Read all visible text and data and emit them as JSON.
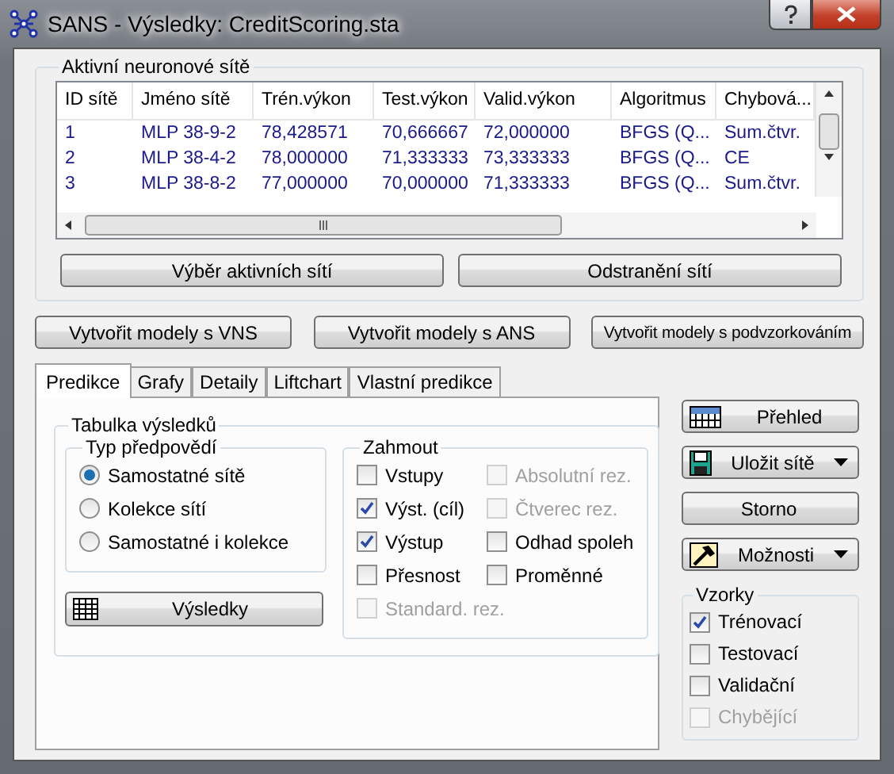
{
  "window": {
    "title": "SANS - Výsledky: CreditScoring.sta"
  },
  "active_networks": {
    "title": "Aktivní neuronové sítě",
    "columns": [
      "ID sítě",
      "Jméno sítě",
      "Trén.výkon",
      "Test.výkon",
      "Valid.výkon",
      "Algoritmus",
      "Chybová..."
    ],
    "rows": [
      [
        "1",
        "MLP 38-9-2",
        "78,428571",
        "70,666667",
        "72,000000",
        "BFGS (Q...",
        "Sum.čtvr."
      ],
      [
        "2",
        "MLP 38-4-2",
        "78,000000",
        "71,333333",
        "73,333333",
        "BFGS (Q...",
        "CE"
      ],
      [
        "3",
        "MLP 38-8-2",
        "77,000000",
        "70,000000",
        "71,333333",
        "BFGS (Q...",
        "Sum.čtvr."
      ]
    ],
    "buttons": [
      "Výběr aktivních sítí",
      "Odstranění sítí"
    ]
  },
  "model_buttons": [
    "Vytvořit modely s VNS",
    "Vytvořit modely s ANS",
    "Vytvořit modely s podvzorkováním"
  ],
  "tabs": [
    {
      "label": "Predikce",
      "selected": true
    },
    {
      "label": "Grafy",
      "selected": false
    },
    {
      "label": "Detaily",
      "selected": false
    },
    {
      "label": "Liftchart",
      "selected": false
    },
    {
      "label": "Vlastní predikce",
      "selected": false
    }
  ],
  "results_table": {
    "title": "Tabulka výsledků",
    "prediction_type": {
      "title": "Typ předpovědí",
      "options": [
        {
          "label": "Samostatné sítě",
          "selected": true
        },
        {
          "label": "Kolekce sítí",
          "selected": false
        },
        {
          "label": "Samostatné i kolekce",
          "selected": false
        }
      ]
    },
    "results_button": {
      "label": "Výsledky",
      "kind": "grid"
    },
    "include": {
      "title": "Zahmout",
      "options": [
        {
          "label": "Vstupy",
          "checked": false,
          "disabled": false
        },
        {
          "label": "Absolutní rez.",
          "checked": false,
          "disabled": true
        },
        {
          "label": "Výst. (cíl)",
          "checked": true,
          "disabled": false
        },
        {
          "label": "Čtverec rez.",
          "checked": false,
          "disabled": true
        },
        {
          "label": "Výstup",
          "checked": true,
          "disabled": false
        },
        {
          "label": "Odhad spoleh",
          "checked": false,
          "disabled": false
        },
        {
          "label": "Přesnost",
          "checked": false,
          "disabled": false
        },
        {
          "label": "Proměnné",
          "checked": false,
          "disabled": false
        },
        {
          "label": "Standard. rez.",
          "checked": false,
          "disabled": true
        }
      ]
    }
  },
  "side_buttons": [
    {
      "label": "Přehled",
      "kind": "summary",
      "dropdown": false
    },
    {
      "label": "Uložit sítě",
      "kind": "save",
      "dropdown": true
    },
    {
      "label": "Storno",
      "kind": "plain",
      "dropdown": false
    },
    {
      "label": "Možnosti",
      "kind": "options",
      "dropdown": true
    }
  ],
  "samples": {
    "title": "Vzorky",
    "options": [
      {
        "label": "Trénovací",
        "checked": true,
        "disabled": false
      },
      {
        "label": "Testovací",
        "checked": false,
        "disabled": false
      },
      {
        "label": "Validační",
        "checked": false,
        "disabled": false
      },
      {
        "label": "Chybějící",
        "checked": false,
        "disabled": true
      }
    ]
  }
}
